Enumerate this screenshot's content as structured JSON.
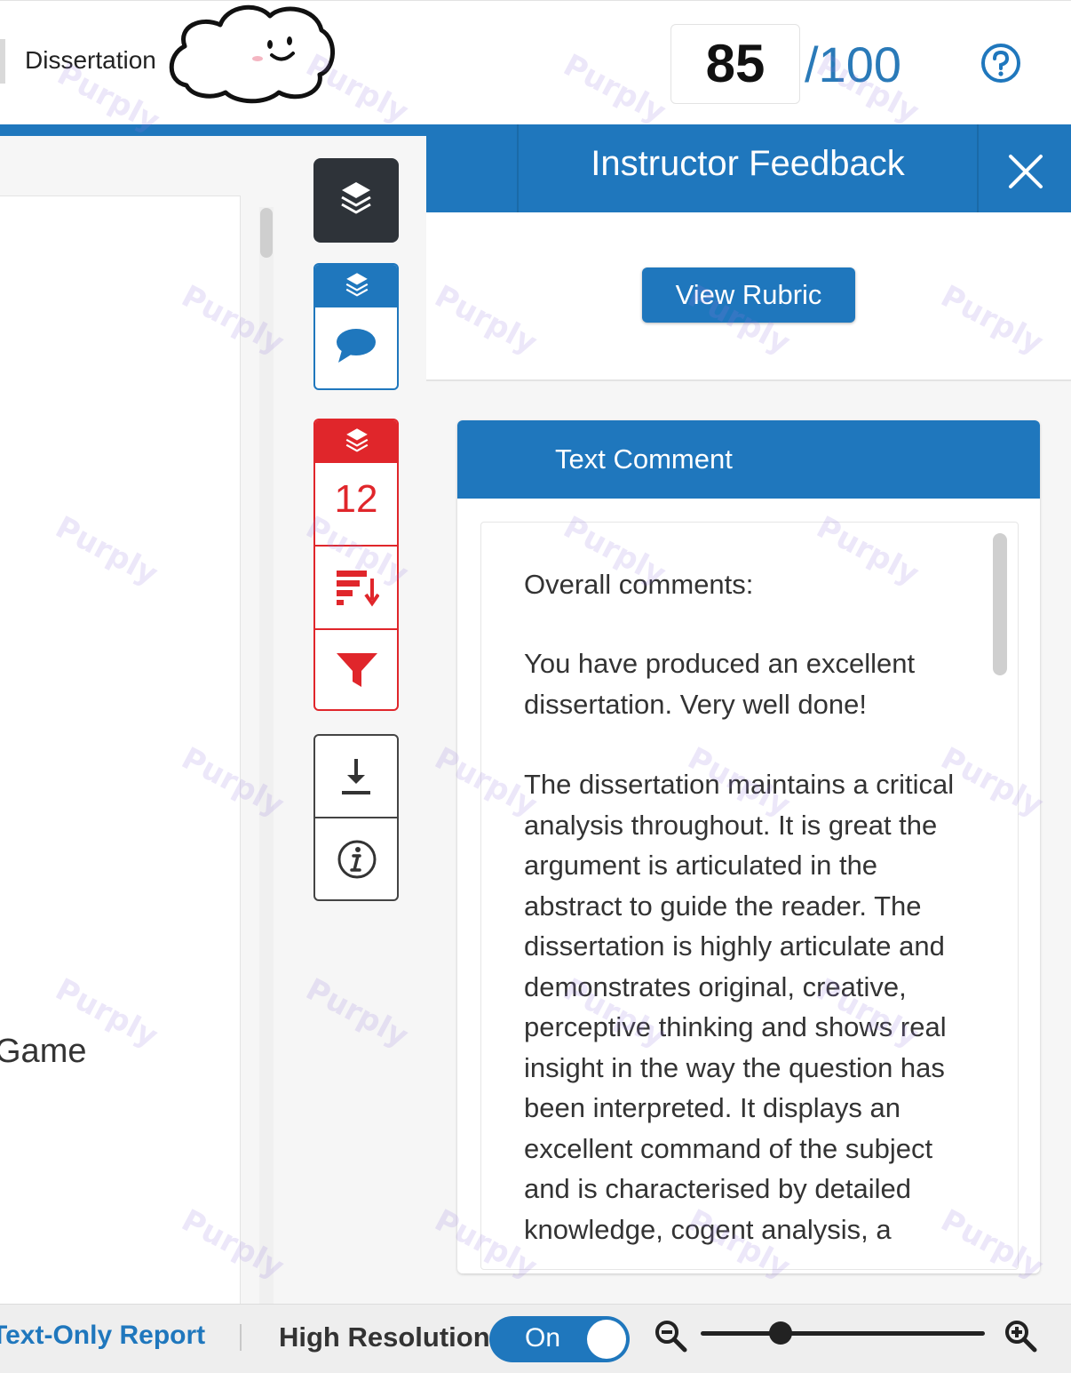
{
  "header": {
    "doc_title": "Dissertation",
    "score": "85",
    "score_max": "/100"
  },
  "document": {
    "visible_text": "Game"
  },
  "tools": {
    "red_count": "12"
  },
  "feedback": {
    "title": "Instructor Feedback",
    "view_rubric_label": "View Rubric",
    "text_comment_title": "Text Comment",
    "overall_heading": "Overall comments:",
    "paragraph1": "You have produced an excellent dissertation. Very well done!",
    "paragraph2": "The dissertation maintains a critical analysis throughout. It is great the argument is articulated in the abstract to guide the reader. The dissertation is highly articulate and demonstrates original, creative, perceptive thinking and shows real insight in the way the question has been interpreted. It displays an excellent command of the subject and is characterised by detailed knowledge, cogent analysis, a"
  },
  "footer": {
    "text_only_report": "Text-Only Report",
    "high_resolution_label": "High Resolution",
    "toggle_state": "On",
    "zoom_level_fraction": 0.28
  },
  "watermark": "Purply",
  "colors": {
    "accent_blue": "#1f77bd",
    "alert_red": "#e0262b",
    "dark_tool": "#2e3339"
  }
}
